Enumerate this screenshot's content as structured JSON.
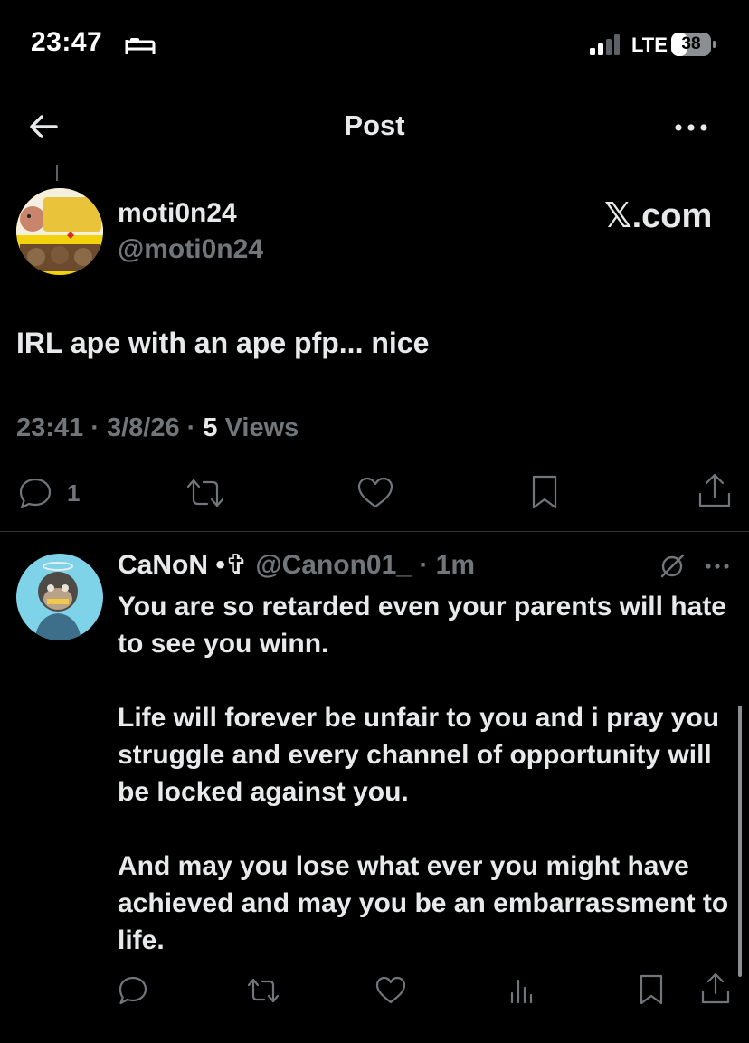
{
  "status_bar": {
    "time": "23:47",
    "network": "LTE",
    "battery": "38"
  },
  "nav": {
    "title": "Post"
  },
  "post": {
    "author_name": "moti0n24",
    "author_handle": "@moti0n24",
    "source_label": "𝕏.com",
    "text": "IRL ape with an ape pfp... nice",
    "time": "23:41",
    "date": "3/8/26",
    "views_count": "5",
    "views_label": "Views",
    "reply_count": "1"
  },
  "reply": {
    "author_name": "CaNoN",
    "author_suffix": "•✞",
    "author_handle": "@Canon01_",
    "age": "1m",
    "paragraphs": [
      "You are so retarded even your parents will hate to see you winn.",
      "Life will forever be unfair to you and i pray you struggle and every channel of opportunity will be locked against you.",
      "And may you lose what ever you might have achieved and may you be an embarrassment to life."
    ]
  },
  "colors": {
    "background": "#000000",
    "text_primary": "#e7e9ea",
    "text_secondary": "#71767b",
    "divider": "#2f3336"
  },
  "icons": {
    "status": [
      "bed-icon",
      "cellular-signal-icon",
      "battery-icon"
    ],
    "nav": [
      "back-arrow-icon",
      "more-icon"
    ],
    "post_actions": [
      "reply-icon",
      "retweet-icon",
      "like-icon",
      "bookmark-icon",
      "share-icon"
    ],
    "reply_actions": [
      "reply-icon",
      "retweet-icon",
      "like-icon",
      "views-stats-icon",
      "bookmark-icon",
      "share-icon"
    ]
  }
}
